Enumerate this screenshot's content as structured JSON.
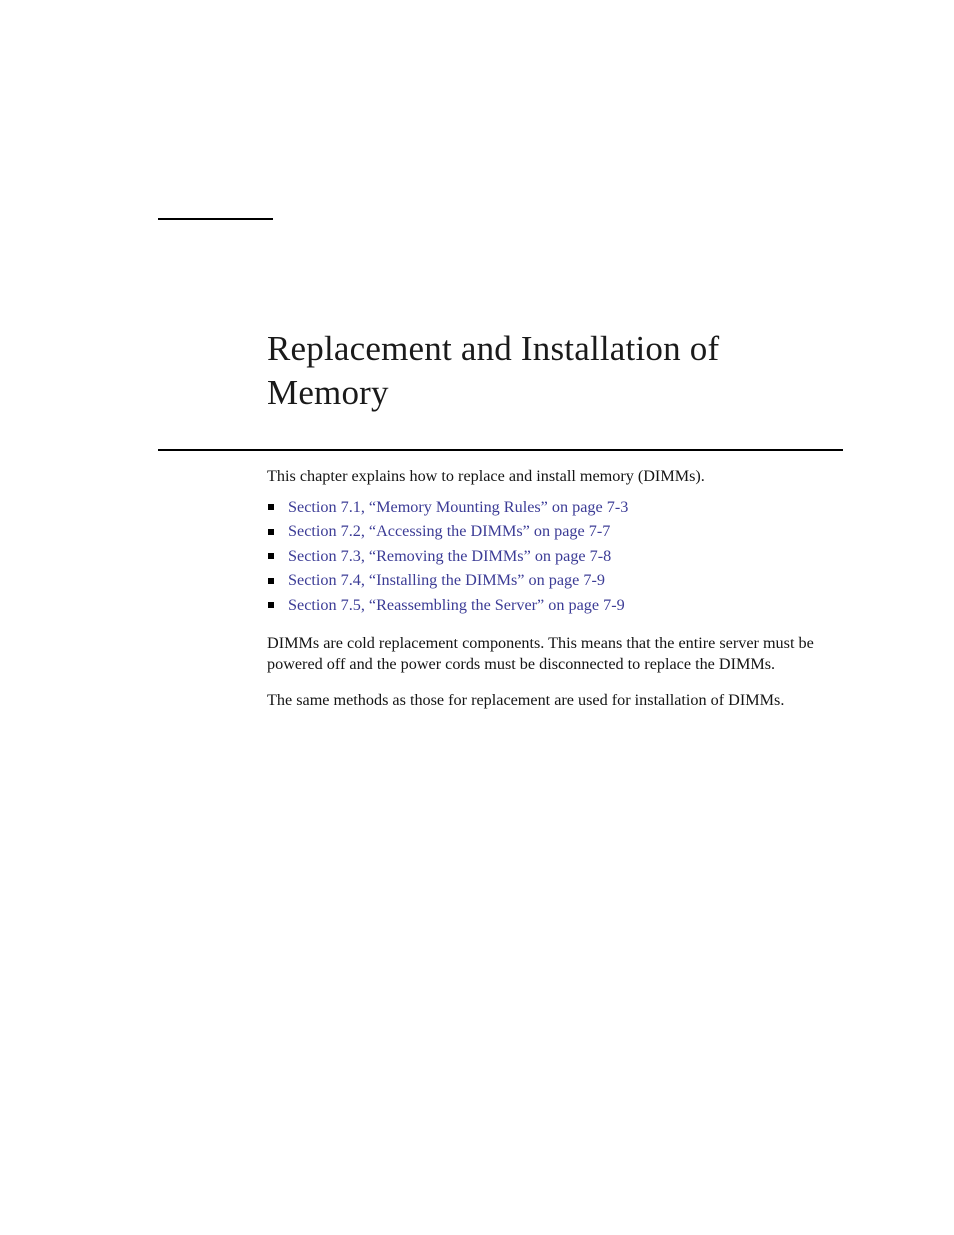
{
  "document": {
    "chapter_title": "Replacement and Installation of Memory",
    "intro_paragraph": "This chapter explains how to replace and install memory (DIMMs).",
    "section_links": [
      {
        "label": "Section 7.1, “Memory Mounting Rules” on page 7-3"
      },
      {
        "label": "Section 7.2, “Accessing the DIMMs” on page 7-7"
      },
      {
        "label": "Section 7.3, “Removing the DIMMs” on page 7-8"
      },
      {
        "label": "Section 7.4, “Installing the DIMMs” on page 7-9"
      },
      {
        "label": "Section 7.5, “Reassembling the Server” on page 7-9"
      }
    ],
    "paragraphs": [
      "DIMMs are cold replacement components. This means that the entire server must be powered off and the power cords must be disconnected to replace the DIMMs.",
      "The same methods as those for replacement are used for installation of DIMMs."
    ]
  },
  "colors": {
    "page_background": "#ffffff",
    "body_text": "#141414",
    "link_text": "#3c3c96",
    "rule": "#000000",
    "bullet": "#000000"
  }
}
